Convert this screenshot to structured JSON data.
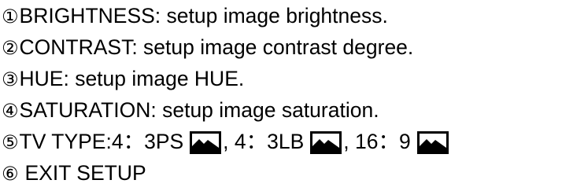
{
  "items": [
    {
      "marker": "①",
      "text": "BRIGHTNESS: setup image brightness."
    },
    {
      "marker": "②",
      "text": "CONTRAST: setup image contrast degree."
    },
    {
      "marker": "③",
      "text": "HUE: setup image HUE."
    },
    {
      "marker": "④",
      "text": "SATURATION: setup image saturation."
    },
    {
      "marker": "⑤",
      "label": "TV TYPE: ",
      "options": [
        {
          "text": "4：3PS",
          "icon": "tv-aspect-icon"
        },
        {
          "text": ", 4：3LB",
          "icon": "tv-aspect-icon"
        },
        {
          "text": ", 16：9",
          "icon": "tv-aspect-icon"
        }
      ]
    },
    {
      "marker": "⑥",
      "text": "EXIT SETUP"
    }
  ]
}
